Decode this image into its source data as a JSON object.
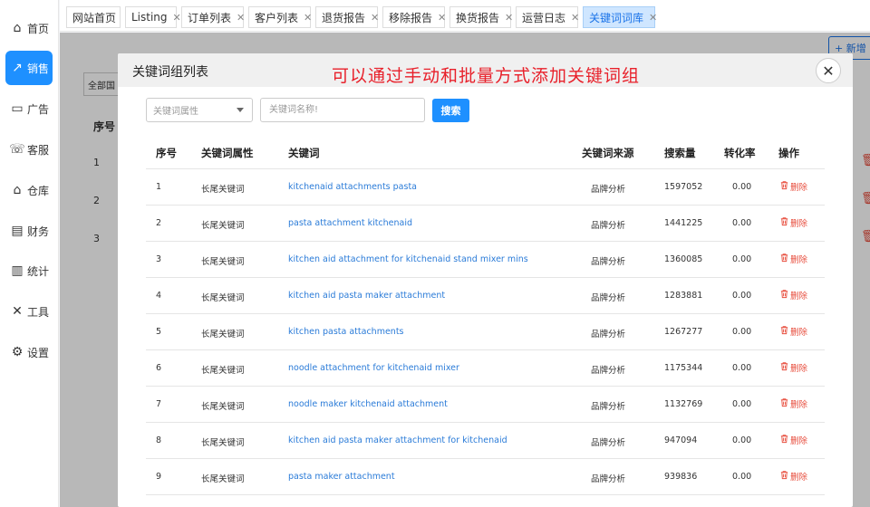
{
  "sidebar": {
    "items": [
      {
        "label": "首页",
        "icon": "home-icon",
        "glyph": "⌂"
      },
      {
        "label": "销售",
        "icon": "chart-line-icon",
        "glyph": "↗"
      },
      {
        "label": "广告",
        "icon": "ad-icon",
        "glyph": "▭"
      },
      {
        "label": "客服",
        "icon": "chat-icon",
        "glyph": "☏"
      },
      {
        "label": "仓库",
        "icon": "warehouse-icon",
        "glyph": "⌂"
      },
      {
        "label": "财务",
        "icon": "finance-icon",
        "glyph": "▤"
      },
      {
        "label": "统计",
        "icon": "bar-chart-icon",
        "glyph": "▥"
      },
      {
        "label": "工具",
        "icon": "tools-icon",
        "glyph": "✕"
      },
      {
        "label": "设置",
        "icon": "gear-icon",
        "glyph": "⚙"
      }
    ],
    "active_index": 1
  },
  "tabs": [
    {
      "label": "网站首页",
      "closable": false
    },
    {
      "label": "Listing",
      "closable": true
    },
    {
      "label": "订单列表",
      "closable": true
    },
    {
      "label": "客户列表",
      "closable": true
    },
    {
      "label": "退货报告",
      "closable": true
    },
    {
      "label": "移除报告",
      "closable": true
    },
    {
      "label": "换货报告",
      "closable": true
    },
    {
      "label": "运营日志",
      "closable": true
    },
    {
      "label": "关键词词库",
      "closable": true,
      "active": true
    }
  ],
  "background": {
    "new_button_label": "+ 新增",
    "filter_label": "全部国",
    "col_header": "序号",
    "rows": [
      "1",
      "2",
      "3"
    ]
  },
  "modal": {
    "title": "关键词组列表",
    "caption": "可以通过手动和批量方式添加关键词组",
    "attr_select_placeholder": "关键词属性",
    "keyword_input_placeholder": "关键词名称!",
    "search_label": "搜索",
    "columns": [
      "序号",
      "关键词属性",
      "关键词",
      "关键词来源",
      "搜索量",
      "转化率",
      "操作"
    ],
    "delete_label": "删除",
    "rows": [
      {
        "no": "1",
        "attr": "长尾关键词",
        "keyword": "kitchenaid attachments pasta",
        "source": "品牌分析",
        "volume": "1597052",
        "rate": "0.00"
      },
      {
        "no": "2",
        "attr": "长尾关键词",
        "keyword": "pasta attachment kitchenaid",
        "source": "品牌分析",
        "volume": "1441225",
        "rate": "0.00"
      },
      {
        "no": "3",
        "attr": "长尾关键词",
        "keyword": "kitchen aid attachment for kitchenaid stand mixer mins",
        "source": "品牌分析",
        "volume": "1360085",
        "rate": "0.00"
      },
      {
        "no": "4",
        "attr": "长尾关键词",
        "keyword": "kitchen aid pasta maker attachment",
        "source": "品牌分析",
        "volume": "1283881",
        "rate": "0.00"
      },
      {
        "no": "5",
        "attr": "长尾关键词",
        "keyword": "kitchen pasta attachments",
        "source": "品牌分析",
        "volume": "1267277",
        "rate": "0.00"
      },
      {
        "no": "6",
        "attr": "长尾关键词",
        "keyword": "noodle attachment for kitchenaid mixer",
        "source": "品牌分析",
        "volume": "1175344",
        "rate": "0.00"
      },
      {
        "no": "7",
        "attr": "长尾关键词",
        "keyword": "noodle maker kitchenaid attachment",
        "source": "品牌分析",
        "volume": "1132769",
        "rate": "0.00"
      },
      {
        "no": "8",
        "attr": "长尾关键词",
        "keyword": "kitchen aid pasta maker attachment for kitchenaid",
        "source": "品牌分析",
        "volume": "947094",
        "rate": "0.00"
      },
      {
        "no": "9",
        "attr": "长尾关键词",
        "keyword": "pasta maker attachment",
        "source": "品牌分析",
        "volume": "939836",
        "rate": "0.00"
      }
    ]
  }
}
